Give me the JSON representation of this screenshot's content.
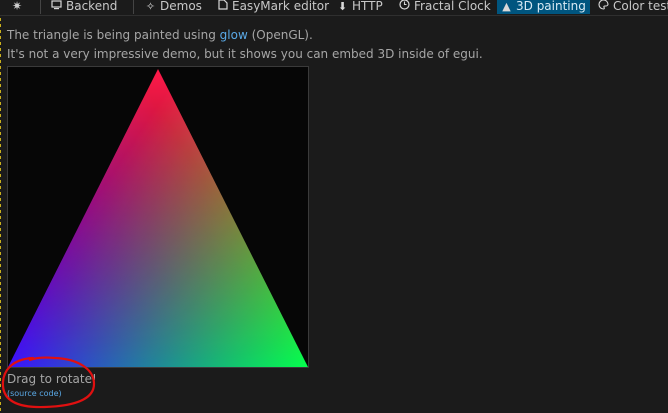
{
  "topbar": {
    "menu_icon": "gear-icon",
    "tabs": [
      {
        "label": "Backend",
        "icon": "computer-icon",
        "active": false
      },
      {
        "label": "Demos",
        "icon": "demos-icon",
        "active": false
      },
      {
        "label": "EasyMark editor",
        "icon": "document-icon",
        "active": false
      },
      {
        "label": "HTTP",
        "icon": "download-icon",
        "active": false
      },
      {
        "label": "Fractal Clock",
        "icon": "clock-icon",
        "active": false
      },
      {
        "label": "3D painting",
        "icon": "triangle-icon",
        "active": true
      },
      {
        "label": "Color test",
        "icon": "palette-icon",
        "active": false
      }
    ]
  },
  "content": {
    "line1_pre": "The triangle is being painted using ",
    "line1_link": "glow",
    "line1_post": " (OpenGL).",
    "line2": "It's not a very impressive demo, but it shows you can embed 3D inside of egui.",
    "hint": "Drag to rotate!",
    "source_link": "(source code)"
  },
  "colors": {
    "accent": "#00557f",
    "link": "#5aa9e6",
    "annotation": "#e01010",
    "vertex_top": "#ff1a4a",
    "vertex_left": "#3a00ff",
    "vertex_right": "#00ff40"
  }
}
